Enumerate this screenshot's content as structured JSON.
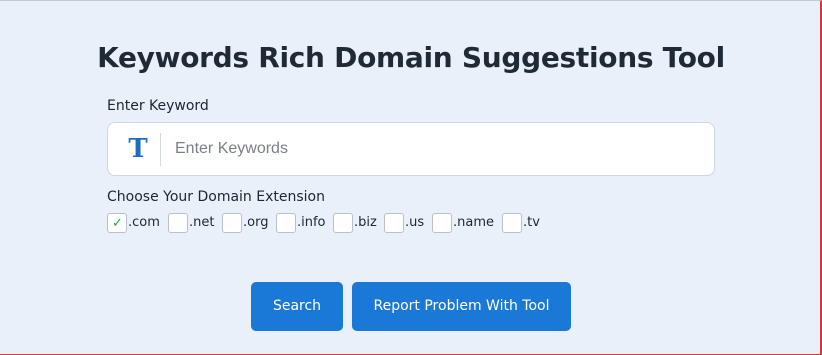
{
  "title": "Keywords Rich Domain Suggestions Tool",
  "keyword": {
    "label": "Enter Keyword",
    "icon_glyph": "T",
    "icon_name": "text-icon",
    "placeholder": "Enter Keywords",
    "value": ""
  },
  "extensions": {
    "label": "Choose Your Domain Extension",
    "check_glyph": "✓",
    "items": [
      {
        "label": ".com",
        "checked": true
      },
      {
        "label": ".net",
        "checked": false
      },
      {
        "label": ".org",
        "checked": false
      },
      {
        "label": ".info",
        "checked": false
      },
      {
        "label": ".biz",
        "checked": false
      },
      {
        "label": ".us",
        "checked": false
      },
      {
        "label": ".name",
        "checked": false
      },
      {
        "label": ".tv",
        "checked": false
      }
    ]
  },
  "buttons": {
    "search": "Search",
    "report": "Report Problem With Tool"
  },
  "colors": {
    "accent": "#1a78d6",
    "background": "#eaf0f9",
    "check": "#2ea04a"
  }
}
